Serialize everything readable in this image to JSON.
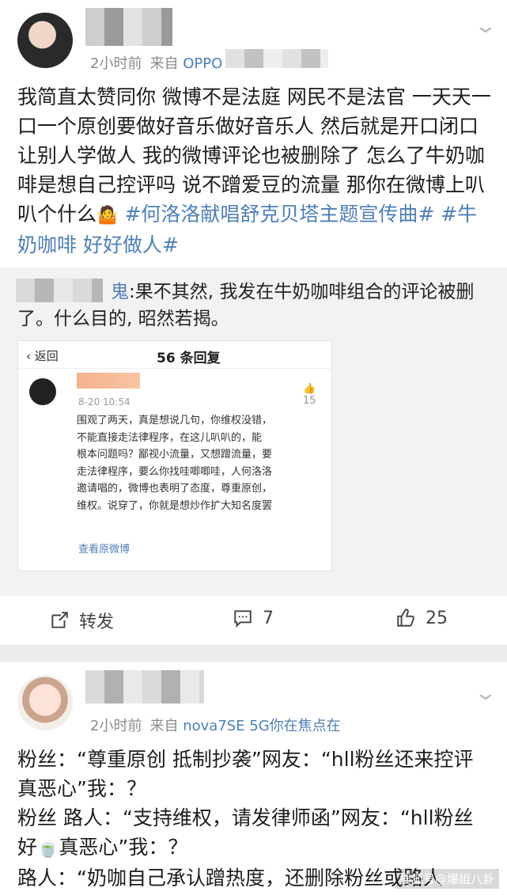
{
  "post1": {
    "time": "2小时前",
    "from_label": "来自",
    "device": "OPPO",
    "text_plain": "我简直太赞同你 微博不是法庭 网民不是法官 一天天一口一个原创要做好音乐做好音乐人 然后就是开口闭口让别人学做人 我的微博评论也被删除了 怎么了牛奶咖啡是想自己控评吗 说不蹭爱豆的流量 那你在微博上叭叭个什么",
    "tags": [
      "#何洛洛献唱舒克贝塔主题宣传曲#",
      "#牛奶咖啡 好好做人#"
    ],
    "repost": {
      "user": "鬼",
      "text": ":果不其然, 我发在牛奶咖啡组合的评论被删了。什么目的, 昭然若揭。",
      "screenshot": {
        "back_label": "返回",
        "reply_count": "56 条回复",
        "date": "8-20 10:54",
        "like_count": "15",
        "lines": [
          "围观了两天，真是想说几句，你维权没错，",
          "不能直接走法律程序，在这儿叭叭的，能",
          "根本问题吗？鄙视小流量，又想蹭流量，要",
          "走法律程序，要么你找哇唧唧哇，人何洛洛",
          "邀请唱的，微博也表明了态度，尊重原创，",
          "维权。说穿了，你就是想炒作扩大知名度罢"
        ],
        "view_original": "查看原微博"
      }
    },
    "actions": {
      "repost_label": "转发",
      "comment_count": "7",
      "like_count": "25"
    }
  },
  "post2": {
    "time": "2小时前",
    "from_label": "来自",
    "device": "nova7SE 5G你在焦点在",
    "lines": [
      "粉丝：“尊重原创 抵制抄袭”网友：“hll粉丝还来控评",
      "真恶心”我：？",
      "粉丝 路人：“支持维权，请发律师函”网友：“hll粉丝",
      "真恶心”我：？",
      "路人：“奶咖自己承认蹭热度，还删除粉丝或路人"
    ],
    "line4_prefix": "好"
  },
  "watermark": "搜狐号@爆姐八卦",
  "colors": {
    "link": "#4d7fb8",
    "divider": "#ececec",
    "repost_bg": "#f2f2f2"
  }
}
